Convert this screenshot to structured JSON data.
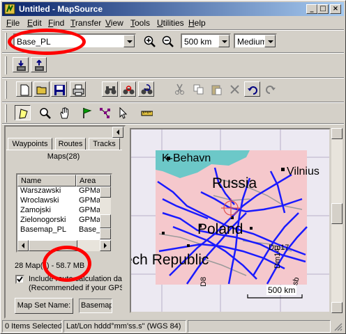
{
  "window": {
    "title": "Untitled - MapSource"
  },
  "menu": [
    "File",
    "Edit",
    "Find",
    "Transfer",
    "View",
    "Tools",
    "Utilities",
    "Help"
  ],
  "toolbar": {
    "map_product": "Base_PL",
    "zoom_scale": "500 km",
    "detail_level": "Medium"
  },
  "tabs": [
    "Waypoints",
    "Routes",
    "Tracks"
  ],
  "maps_panel": {
    "heading": "Maps(28)",
    "columns": [
      "Name",
      "Area"
    ],
    "rows": [
      [
        "Warszawski",
        "GPMap"
      ],
      [
        "Wroclawski",
        "GPMap"
      ],
      [
        "Zamojski",
        "GPMap"
      ],
      [
        "Zielonogorski",
        "GPMap"
      ],
      [
        "Basemap_PL",
        "Base_"
      ]
    ],
    "summary": "28 Map(s) - 58.7 MB",
    "checkbox_line1": "Include route calculation da",
    "checkbox_line2": "(Recommended if your GPS",
    "checkbox_checked": true,
    "map_set_name_button": "Map Set Name:",
    "map_set_name_value": "Basemap"
  },
  "map": {
    "labels": {
      "copenhagen": "K-Behavn",
      "vilnius": "Vilnius",
      "russia": "Russia",
      "poland": "Poland",
      "czech": "ech Republic",
      "road_dm17": "Dm17",
      "road_dm14": "Dm14",
      "road_dsb": "Dsb",
      "road_d8": "D8"
    },
    "scale_label": "500 km",
    "colors": {
      "land": "#f5c8cc",
      "sea": "#6cc8c8",
      "roads": "#1a1aff",
      "border": "#9a9a9a",
      "cursor": "#e05050"
    }
  },
  "status": {
    "selection": "0 Items Selected",
    "coord_format": "Lat/Lon hddd°mm'ss.s\" (WGS 84)"
  }
}
